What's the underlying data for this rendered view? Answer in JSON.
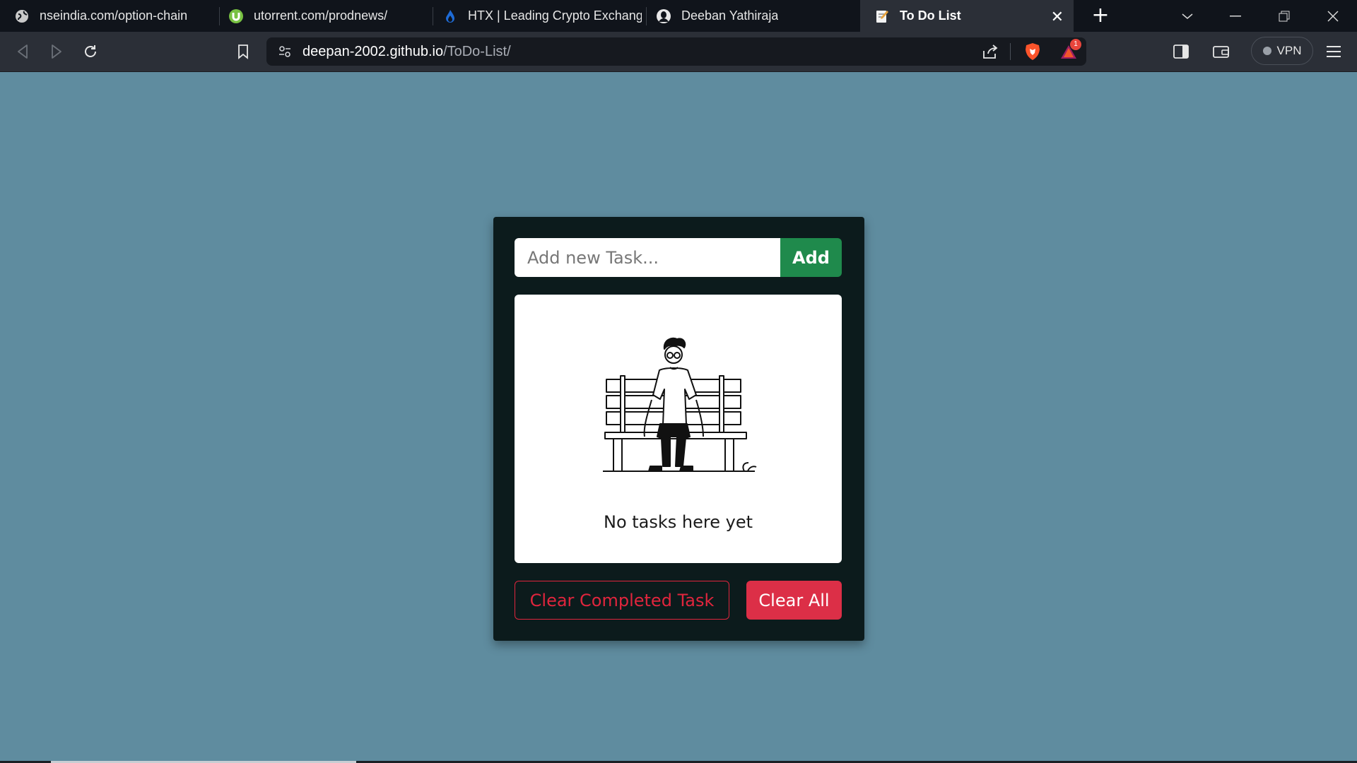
{
  "browser": {
    "tabs": [
      {
        "title": "nseindia.com/option-chain",
        "icon": "globe-icon"
      },
      {
        "title": "utorrent.com/prodnews/",
        "icon": "utorrent-icon"
      },
      {
        "title": "HTX | Leading Crypto Exchange",
        "icon": "htx-flame-icon"
      },
      {
        "title": "Deeban Yathiraja",
        "icon": "github-avatar-icon"
      },
      {
        "title": "To Do List",
        "icon": "todo-pencil-icon",
        "active": true
      }
    ],
    "url_host": "deepan-2002.github.io",
    "url_path": "/ToDo-List/",
    "vpn_label": "VPN",
    "rewards_badge": "1"
  },
  "app": {
    "input_placeholder": "Add new Task...",
    "input_value": "",
    "add_label": "Add",
    "empty_message": "No tasks here yet",
    "clear_completed_label": "Clear Completed Task",
    "clear_all_label": "Clear All",
    "colors": {
      "background": "#5f8c9f",
      "card": "#0c1b1c",
      "add_button": "#1f8a4c",
      "danger": "#dc2f47"
    }
  }
}
